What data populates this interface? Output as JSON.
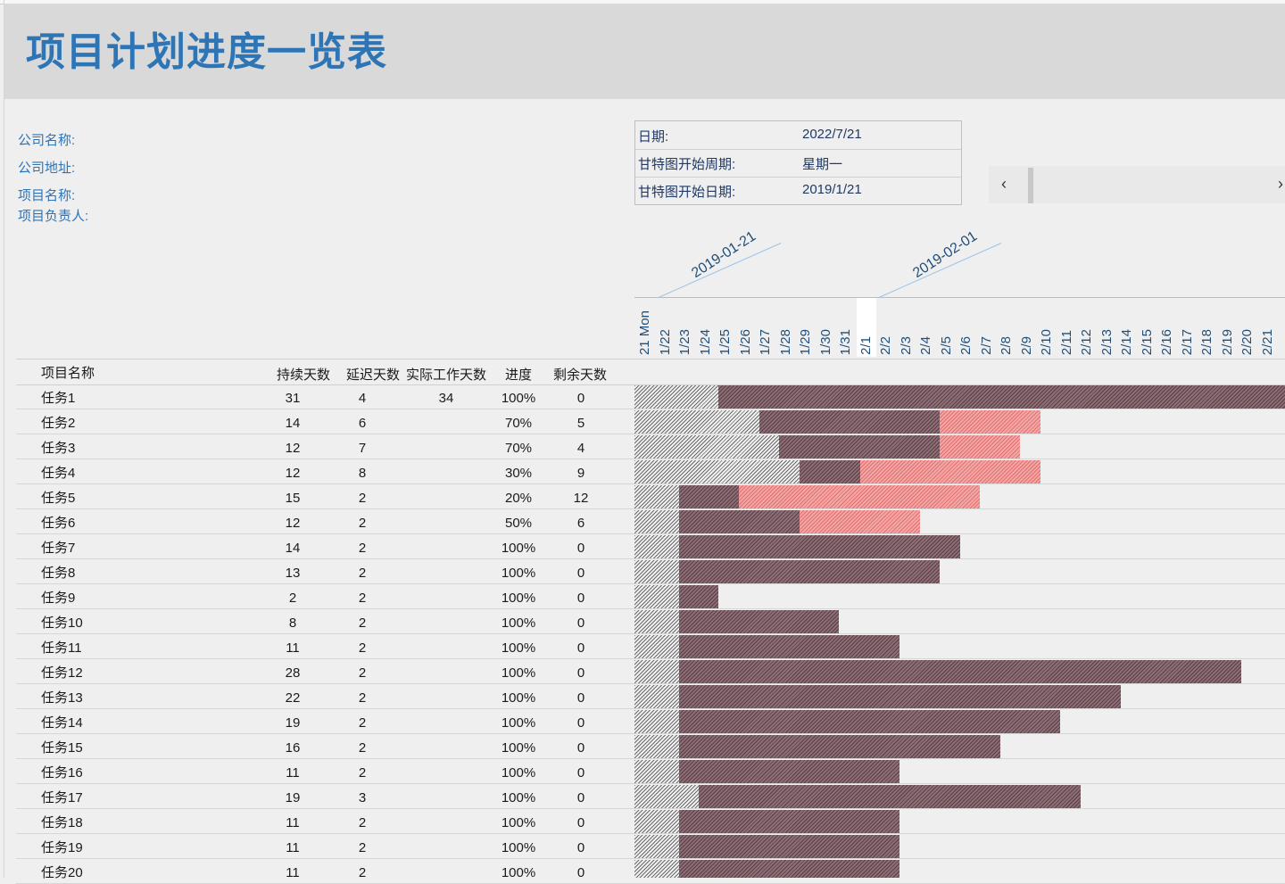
{
  "title": "项目计划进度一览表",
  "info": {
    "company_name": "公司名称:",
    "company_address": "公司地址:",
    "project_name": "项目名称:",
    "project_owner": "项目负责人:"
  },
  "meta": {
    "date_label": "日期:",
    "date_value": "2022/7/21",
    "week_label": "甘特图开始周期:",
    "week_value": "星期一",
    "start_label": "甘特图开始日期:",
    "start_value": "2019/1/21"
  },
  "scroller": {
    "left_icon": "‹",
    "right_icon": "›"
  },
  "date_flags": [
    "2019-01-21",
    "2019-02-01"
  ],
  "days": [
    "21 Mon",
    "1/22",
    "1/23",
    "1/24",
    "1/25",
    "1/26",
    "1/27",
    "1/28",
    "1/29",
    "1/30",
    "1/31",
    "2/1",
    "2/2",
    "2/3",
    "2/4",
    "2/5",
    "2/6",
    "2/7",
    "2/8",
    "2/9",
    "2/10",
    "2/11",
    "2/12",
    "2/13",
    "2/14",
    "2/15",
    "2/16",
    "2/17",
    "2/18",
    "2/19",
    "2/20",
    "2/21"
  ],
  "today_index": 11,
  "headers": {
    "name": "项目名称",
    "duration": "持续天数",
    "delay": "延迟天数",
    "actual": "实际工作天数",
    "progress": "进度",
    "remaining": "剩余天数"
  },
  "tasks": [
    {
      "name": "任务1",
      "duration": "31",
      "delay": "4",
      "actual": "34",
      "progress": "100%",
      "remaining": "0"
    },
    {
      "name": "任务2",
      "duration": "14",
      "delay": "6",
      "actual": "",
      "progress": "70%",
      "remaining": "5"
    },
    {
      "name": "任务3",
      "duration": "12",
      "delay": "7",
      "actual": "",
      "progress": "70%",
      "remaining": "4"
    },
    {
      "name": "任务4",
      "duration": "12",
      "delay": "8",
      "actual": "",
      "progress": "30%",
      "remaining": "9"
    },
    {
      "name": "任务5",
      "duration": "15",
      "delay": "2",
      "actual": "",
      "progress": "20%",
      "remaining": "12"
    },
    {
      "name": "任务6",
      "duration": "12",
      "delay": "2",
      "actual": "",
      "progress": "50%",
      "remaining": "6"
    },
    {
      "name": "任务7",
      "duration": "14",
      "delay": "2",
      "actual": "",
      "progress": "100%",
      "remaining": "0"
    },
    {
      "name": "任务8",
      "duration": "13",
      "delay": "2",
      "actual": "",
      "progress": "100%",
      "remaining": "0"
    },
    {
      "name": "任务9",
      "duration": "2",
      "delay": "2",
      "actual": "",
      "progress": "100%",
      "remaining": "0"
    },
    {
      "name": "任务10",
      "duration": "8",
      "delay": "2",
      "actual": "",
      "progress": "100%",
      "remaining": "0"
    },
    {
      "name": "任务11",
      "duration": "11",
      "delay": "2",
      "actual": "",
      "progress": "100%",
      "remaining": "0"
    },
    {
      "name": "任务12",
      "duration": "28",
      "delay": "2",
      "actual": "",
      "progress": "100%",
      "remaining": "0"
    },
    {
      "name": "任务13",
      "duration": "22",
      "delay": "2",
      "actual": "",
      "progress": "100%",
      "remaining": "0"
    },
    {
      "name": "任务14",
      "duration": "19",
      "delay": "2",
      "actual": "",
      "progress": "100%",
      "remaining": "0"
    },
    {
      "name": "任务15",
      "duration": "16",
      "delay": "2",
      "actual": "",
      "progress": "100%",
      "remaining": "0"
    },
    {
      "name": "任务16",
      "duration": "11",
      "delay": "2",
      "actual": "",
      "progress": "100%",
      "remaining": "0"
    },
    {
      "name": "任务17",
      "duration": "19",
      "delay": "3",
      "actual": "",
      "progress": "100%",
      "remaining": "0"
    },
    {
      "name": "任务18",
      "duration": "11",
      "delay": "2",
      "actual": "",
      "progress": "100%",
      "remaining": "0"
    },
    {
      "name": "任务19",
      "duration": "11",
      "delay": "2",
      "actual": "",
      "progress": "100%",
      "remaining": "0"
    },
    {
      "name": "任务20",
      "duration": "11",
      "delay": "2",
      "actual": "",
      "progress": "100%",
      "remaining": "0"
    }
  ],
  "colors": {
    "title": "#2e75b6",
    "bar_before": "#6b6b6b",
    "bar_done": "#5a3e44",
    "bar_delay": "#e06f6f"
  }
}
